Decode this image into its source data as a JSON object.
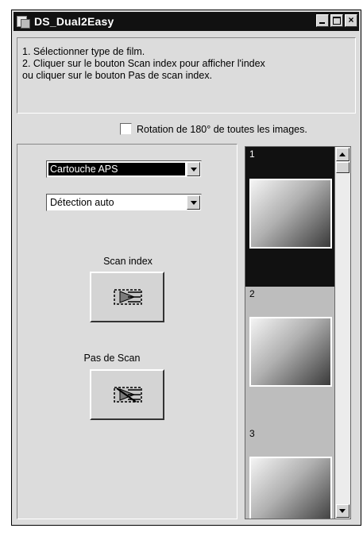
{
  "window": {
    "title": "DS_Dual2Easy",
    "app_icon": "film-scanner-icon",
    "controls": {
      "minimize": "minimize-icon",
      "maximize": "maximize-icon",
      "close_label": "×"
    }
  },
  "instructions": {
    "line1": "1. Sélectionner type de film.",
    "line2": "2. Cliquer sur le bouton Scan index pour afficher l'index",
    "line3": "ou cliquer sur le bouton Pas de scan  index."
  },
  "rotation": {
    "label": "Rotation de 180° de toutes les images.",
    "checked": false
  },
  "film_type": {
    "selected": "Cartouche APS"
  },
  "detection": {
    "selected": "Détection auto"
  },
  "scan_index": {
    "label": "Scan index",
    "icon": "scan-index-icon"
  },
  "no_scan": {
    "label": "Pas de Scan",
    "icon": "no-scan-icon"
  },
  "thumbnails": [
    {
      "number": "1",
      "selected": true
    },
    {
      "number": "2",
      "selected": false
    },
    {
      "number": "3",
      "selected": false
    }
  ],
  "colors": {
    "titlebar": "#111111",
    "face": "#dcdcdc",
    "selection": "#000000"
  }
}
